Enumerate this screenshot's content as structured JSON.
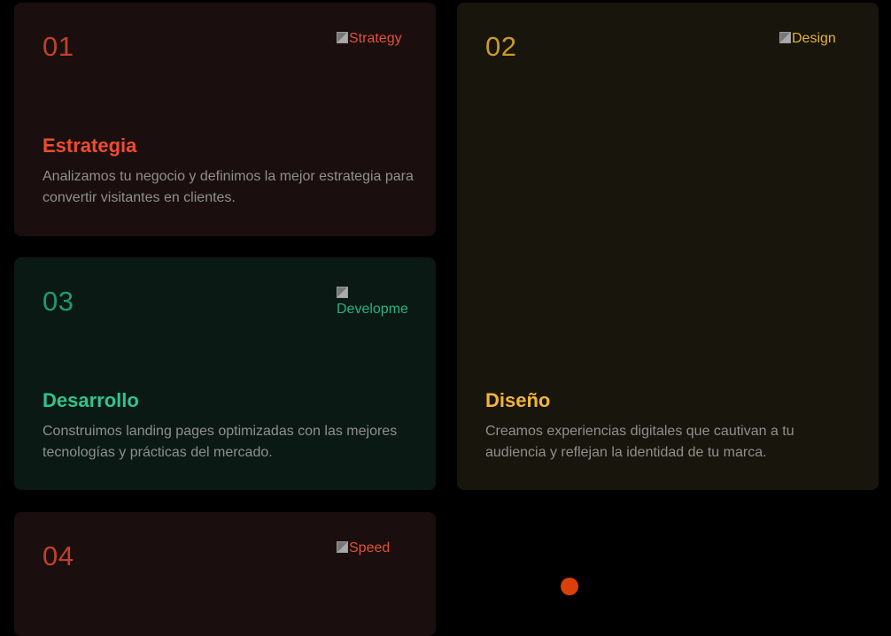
{
  "cards": [
    {
      "number": "01",
      "image_alt": "Strategy",
      "title": "Estrategia",
      "description": "Analizamos tu negocio y definimos la mejor estrategia para convertir visitantes en clientes."
    },
    {
      "number": "02",
      "image_alt": "Design",
      "title": "Diseño",
      "description": "Creamos experiencias digitales que cautivan a tu audiencia y reflejan la identidad de tu marca."
    },
    {
      "number": "03",
      "image_alt": "Development",
      "title": "Desarrollo",
      "description": "Construimos landing pages optimizadas con las mejores tecnologías y prácticas del mercado."
    },
    {
      "number": "04",
      "image_alt": "Speed"
    }
  ],
  "colors": {
    "background": "#000000",
    "accent_red": "#f04b30",
    "accent_yellow": "#f2b53a",
    "accent_green": "#2ec48f",
    "indicator": "#d9400a"
  }
}
